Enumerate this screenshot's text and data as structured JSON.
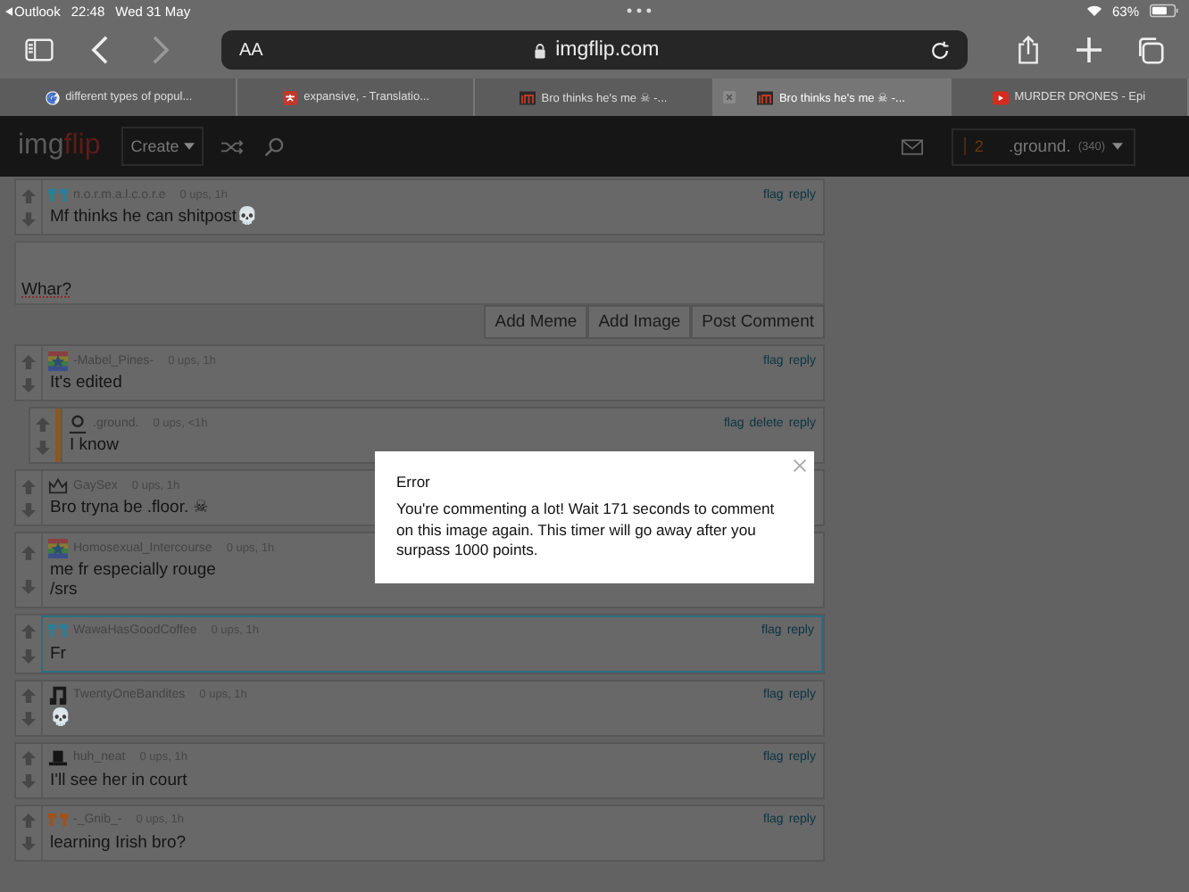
{
  "status_bar": {
    "back_app": "Outlook",
    "time": "22:48",
    "date": "Wed 31 May",
    "battery": "63%"
  },
  "toolbar": {
    "reader_button": "AA",
    "url": "imgflip.com",
    "forward_disabled": true
  },
  "tabs": [
    {
      "title": "different types of popul...",
      "kind": "google",
      "selected": false
    },
    {
      "title": "expansive, - Translatio...",
      "kind": "translate",
      "selected": false
    },
    {
      "title": "Bro thinks he's me ☠ -...",
      "kind": "imgflip",
      "selected": false
    },
    {
      "title": "Bro thinks he's me ☠ -...",
      "kind": "imgflip",
      "selected": true
    },
    {
      "title": "MURDER DRONES - Epi",
      "kind": "youtube",
      "selected": false
    }
  ],
  "site_nav": {
    "logo": [
      "img",
      "flip"
    ],
    "create": "Create",
    "notifications": "2",
    "user": ".ground.",
    "points": "(340)"
  },
  "comments_before": [
    {
      "kind": "teal-pixel",
      "user": "n.o.r.m.a.l.c.o.r.e",
      "meta": "0 ups, 1h",
      "actions": [
        "flag",
        "reply"
      ],
      "text": "Mf thinks he can shitpost💀",
      "highlighted": false,
      "own": false
    }
  ],
  "comment_form": {
    "value": "Whar?",
    "buttons": [
      "Add Meme",
      "Add Image",
      "Post Comment"
    ]
  },
  "comments": [
    {
      "kind": "rainbow",
      "user": "-Mabel_Pines-",
      "meta": "0 ups, 1h",
      "actions": [
        "flag",
        "reply"
      ],
      "text": "It's edited",
      "highlighted": false,
      "own": false,
      "children": [
        {
          "kind": "person",
          "user": ".ground.",
          "meta": "0 ups, <1h",
          "actions": [
            "flag",
            "delete",
            "reply"
          ],
          "text": "I know",
          "highlighted": false,
          "own": true
        }
      ]
    },
    {
      "kind": "crown",
      "user": "GaySex",
      "meta": "0 ups, 1h",
      "text": "Bro tryna be .floor. ☠",
      "highlighted": false,
      "own": false
    },
    {
      "kind": "rainbow",
      "user": "Homosexual_Intercourse",
      "meta": "0 ups, 1h",
      "text": "me fr especially rouge\n/srs",
      "highlighted": false,
      "own": false
    },
    {
      "kind": "teal-pixel",
      "user": "WawaHasGoodCoffee",
      "meta": "0 ups, 1h",
      "actions": [
        "flag",
        "reply"
      ],
      "text": "Fr",
      "highlighted": true,
      "own": false
    },
    {
      "kind": "note",
      "user": "TwentyOneBandites",
      "meta": "0 ups, 1h",
      "actions": [
        "flag",
        "reply"
      ],
      "text": "💀",
      "highlighted": false,
      "own": false
    },
    {
      "kind": "hat",
      "user": "huh_neat",
      "meta": "0 ups, 1h",
      "actions": [
        "flag",
        "reply"
      ],
      "text": "I'll see her in court",
      "highlighted": false,
      "own": false
    },
    {
      "kind": "orange-pixel",
      "user": "-_Gnib_-",
      "meta": "0 ups, 1h",
      "actions": [
        "flag",
        "reply"
      ],
      "text": "learning Irish bro?",
      "highlighted": false,
      "own": false
    }
  ],
  "error_dialog": {
    "title": "Error",
    "message": "You're commenting a lot! Wait 171 seconds to comment on this image again. This timer will go away after you surpass 1000 points."
  }
}
